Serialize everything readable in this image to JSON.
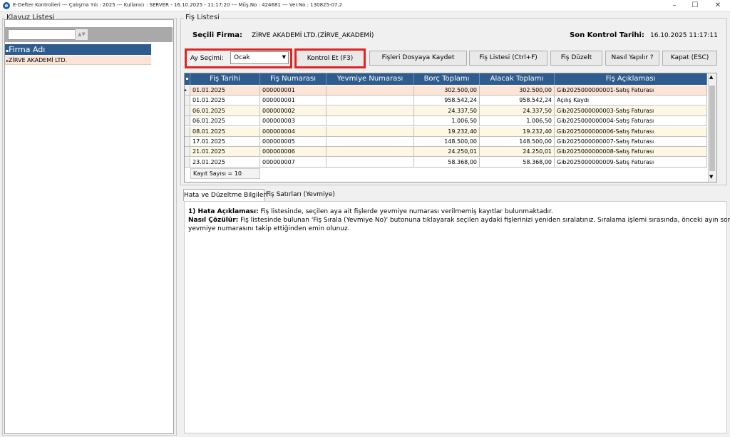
{
  "window": {
    "title": "E-Defter Kontrolleri  ---  Çalışma Yılı : 2025  ---  Kullanıcı : SERVER - 16.10.2025 - 11:17:20  ---  Müş.No : 424681  ---  Ver.No : 130825-07.2",
    "minimize": "–",
    "maximize": "☐",
    "close": "✕"
  },
  "klavuz": {
    "title": "Klavuz Listesi",
    "column_header": "Firma Adı",
    "rows": [
      "ZİRVE AKADEMİ LTD."
    ]
  },
  "fis": {
    "title": "Fiş Listesi",
    "firma_label": "Seçili Firma:",
    "firma_value": "ZİRVE AKADEMİ LTD.(ZİRVE_AKADEMİ)",
    "kontrol_label": "Son Kontrol Tarihi:",
    "kontrol_value": "16.10.2025 11:17:11",
    "ay_label": "Ay Seçimi:",
    "ay_value": "Ocak",
    "buttons": {
      "kontrol": "Kontrol Et (F3)",
      "kaydet": "Fişleri Dosyaya Kaydet",
      "listesi": "Fiş Listesi (Ctrl+F)",
      "duzelt": "Fiş Düzelt",
      "nasil": "Nasıl Yapılır ?",
      "kapat": "Kapat (ESC)"
    },
    "columns": [
      "Fiş Tarihi",
      "Fiş Numarası",
      "Yevmiye Numarası",
      "Borç Toplamı",
      "Alacak Toplamı",
      "Fiş Açıklaması"
    ],
    "rows": [
      {
        "tarih": "01.01.2025",
        "numara": "000000001",
        "yevmiye": "",
        "borc": "302.500,00",
        "alacak": "302.500,00",
        "aciklama": "Gib2025000000001-Satış Faturası"
      },
      {
        "tarih": "01.01.2025",
        "numara": "000000001",
        "yevmiye": "",
        "borc": "958.542,24",
        "alacak": "958.542,24",
        "aciklama": "Açılış Kaydı"
      },
      {
        "tarih": "06.01.2025",
        "numara": "000000002",
        "yevmiye": "",
        "borc": "24.337,50",
        "alacak": "24.337,50",
        "aciklama": "Gib2025000000003-Satış Faturası"
      },
      {
        "tarih": "06.01.2025",
        "numara": "000000003",
        "yevmiye": "",
        "borc": "1.006,50",
        "alacak": "1.006,50",
        "aciklama": "Gib2025000000004-Satış Faturası"
      },
      {
        "tarih": "08.01.2025",
        "numara": "000000004",
        "yevmiye": "",
        "borc": "19.232,40",
        "alacak": "19.232,40",
        "aciklama": "Gib2025000000006-Satış Faturası"
      },
      {
        "tarih": "17.01.2025",
        "numara": "000000005",
        "yevmiye": "",
        "borc": "148.500,00",
        "alacak": "148.500,00",
        "aciklama": "Gib2025000000007-Satış Faturası"
      },
      {
        "tarih": "21.01.2025",
        "numara": "000000006",
        "yevmiye": "",
        "borc": "24.250,01",
        "alacak": "24.250,01",
        "aciklama": "Gib2025000000008-Satış Faturası"
      },
      {
        "tarih": "23.01.2025",
        "numara": "000000007",
        "yevmiye": "",
        "borc": "58.368,00",
        "alacak": "58.368,00",
        "aciklama": "Gib2025000000009-Satış Faturası"
      }
    ],
    "kayit_sayisi": "Kayıt Sayısı = 10"
  },
  "tabs": [
    "Hata ve Düzeltme Bilgileri",
    "Fiş Satırları (Yevmiye)"
  ],
  "info": {
    "hata_label": "1) Hata Açıklaması:",
    "hata_text": " Fiş listesinde, seçilen aya ait fişlerde yevmiye numarası verilmemiş kayıtlar bulunmaktadır.",
    "cozum_label": "Nasıl Çözülür:",
    "cozum_text": " Fiş listesinde bulunan 'Fiş Sırala (Yevmiye No)' butonuna tıklayarak seçilen aydaki fişlerinizi yeniden sıralatınız. Sıralama işlemi sırasında, önceki ayın son",
    "cozum_text2": "yevmiye numarasını takip ettiğinden emin olunuz."
  },
  "colors": {
    "header_blue": "#2f5c8f",
    "selected_row": "#fce4d6",
    "alt_row": "#fdf7e3",
    "highlight_red": "#e52222"
  }
}
